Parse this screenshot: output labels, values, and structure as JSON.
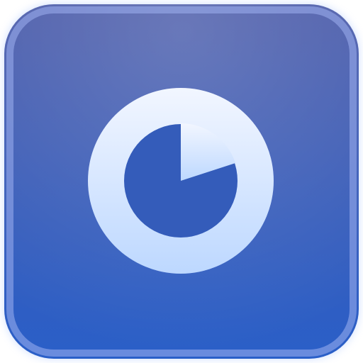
{
  "icon": {
    "name": "pie-timer-icon",
    "remaining_fraction": 0.8,
    "colors": {
      "tile_top": "#4a5aa8",
      "tile_bottom": "#2a5fc8",
      "tile_border": "#9fb0f0",
      "glyph_top": "#f2f6ff",
      "glyph_bottom": "#bdd8ff",
      "inner_fill": "#345cba"
    }
  }
}
